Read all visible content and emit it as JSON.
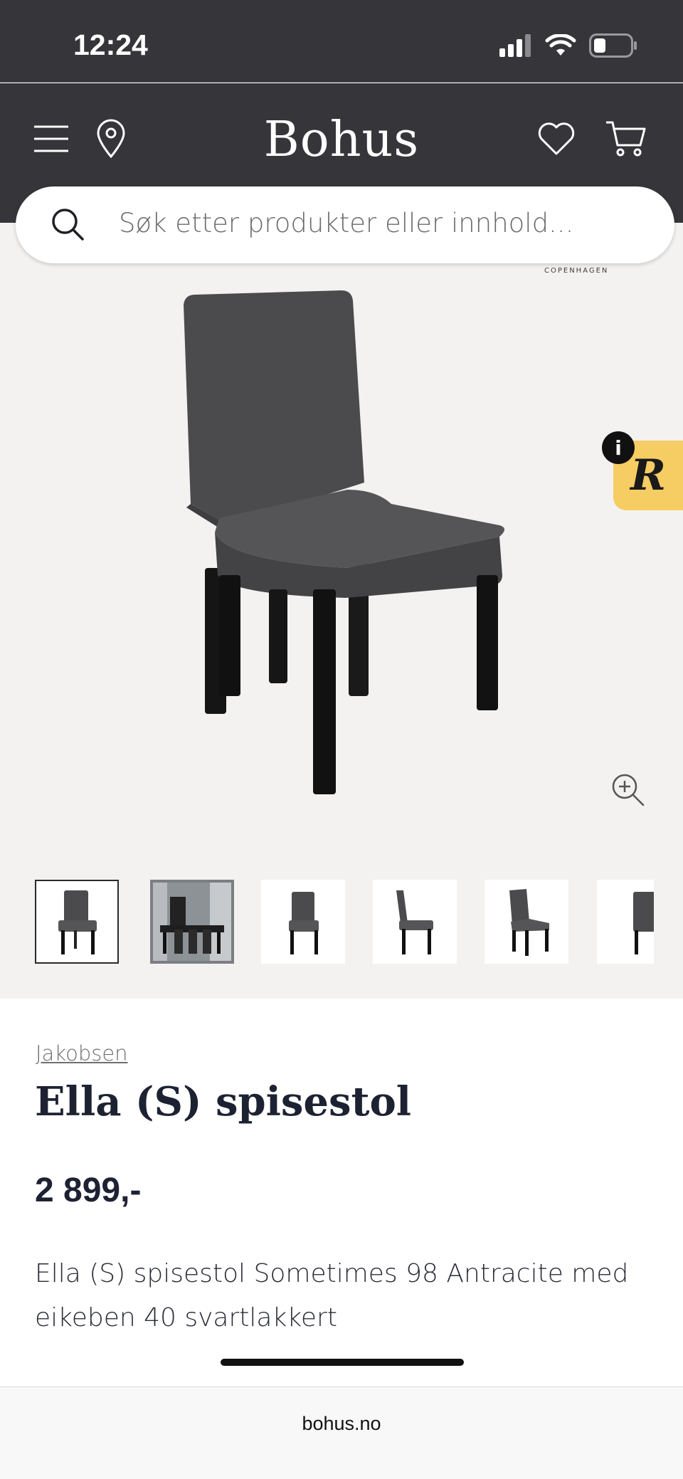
{
  "status_bar": {
    "time": "12:24"
  },
  "header": {
    "logo": "Bohus",
    "icons": [
      "menu-icon",
      "location-pin-icon",
      "heart-icon",
      "cart-icon"
    ]
  },
  "search": {
    "placeholder": "Søk etter produkter eller innhold..."
  },
  "gallery": {
    "brand_tag": "COPENHAGEN",
    "badge_letter": "R",
    "info_letter": "i",
    "thumbnails": [
      "chair-front",
      "dining-room",
      "chair-front",
      "chair-side",
      "chair-angle",
      "chair-back"
    ],
    "active_thumbnail": 1
  },
  "product": {
    "brand": "Jakobsen",
    "title": "Ella (S) spisestol",
    "price": "2 899,-",
    "description": "Ella (S) spisestol Sometimes 98 Antracite med eikeben 40 svartlakkert"
  },
  "browser": {
    "url": "bohus.no"
  },
  "colors": {
    "header_bg": "#35353a",
    "gallery_bg": "#f4f2f1",
    "badge": "#f6cd63",
    "text_dark": "#1d2233"
  }
}
